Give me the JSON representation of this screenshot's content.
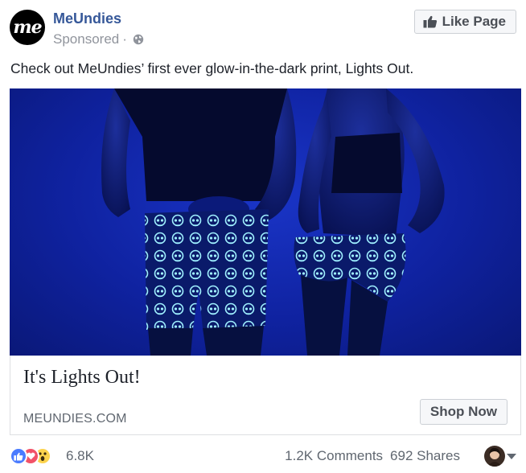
{
  "header": {
    "avatar_text": "me",
    "page_name": "MeUndies",
    "sponsored": "Sponsored",
    "separator": "·",
    "like_button": "Like Page"
  },
  "post": {
    "text": "Check out MeUndies’ first ever glow-in-the-dark print, Lights Out."
  },
  "card": {
    "title": "It's Lights Out!",
    "domain": "MEUNDIES.COM",
    "cta": "Shop Now"
  },
  "footer": {
    "reaction_count": "6.8K",
    "comments": "1.2K Comments",
    "shares": "692 Shares"
  },
  "colors": {
    "link_blue": "#365899",
    "image_blue": "#1029b0",
    "glow": "#8fe0ff"
  }
}
